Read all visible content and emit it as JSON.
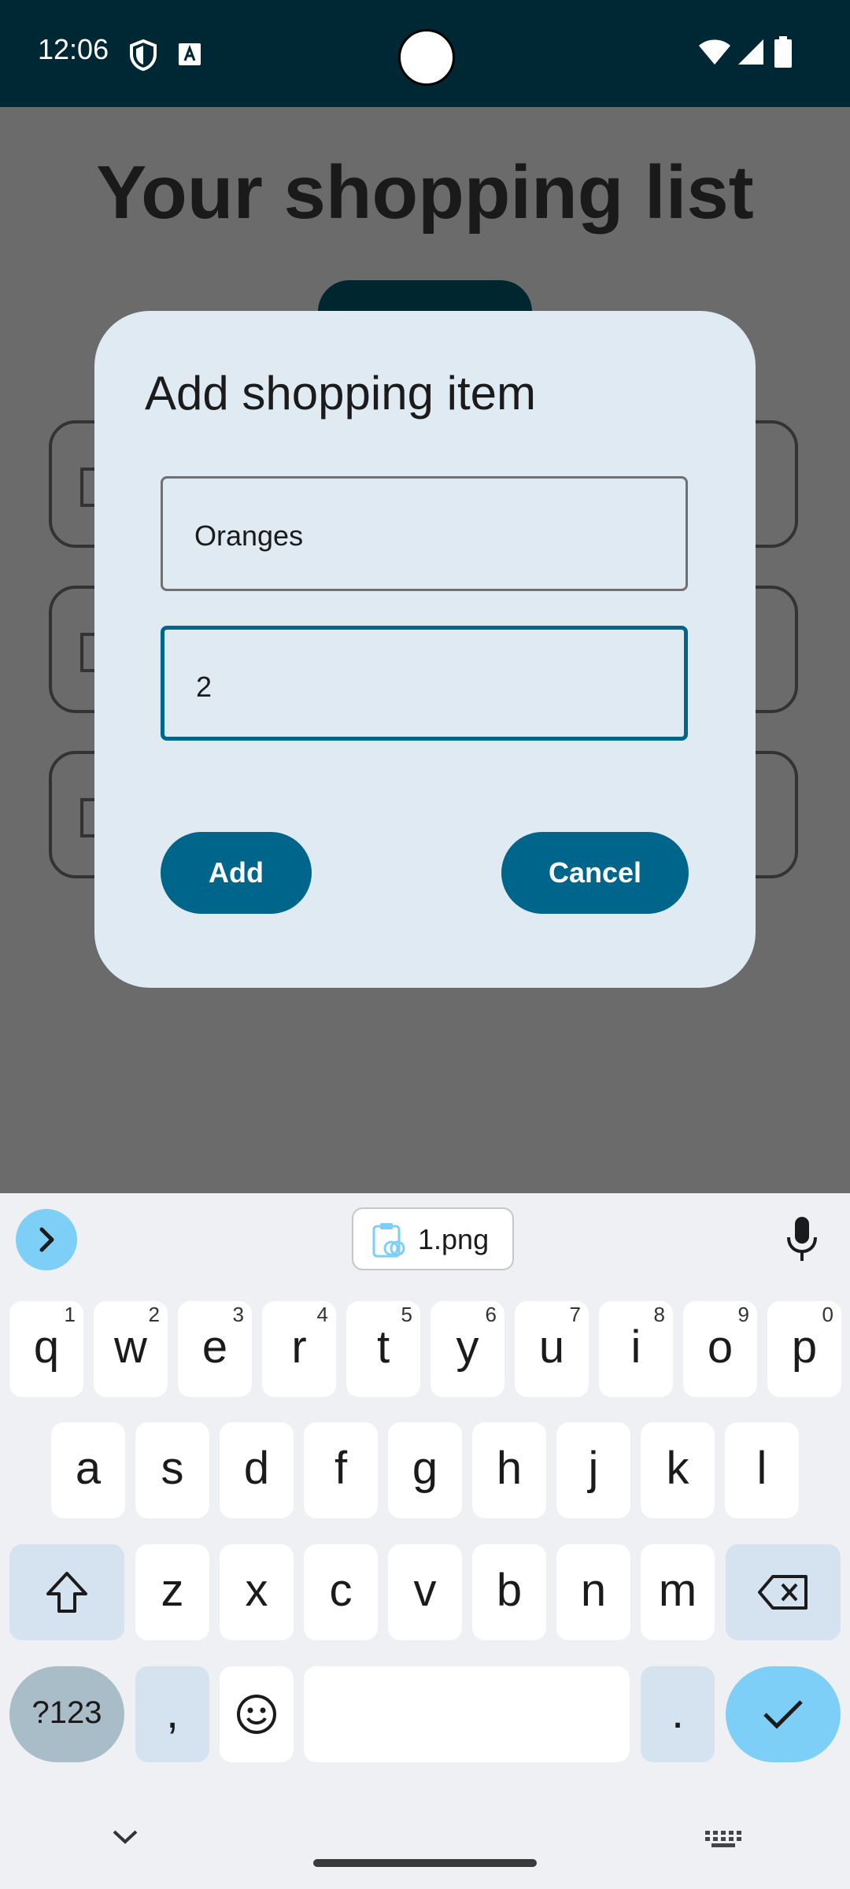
{
  "status_bar": {
    "time": "12:06",
    "icons": [
      "shield-icon",
      "a-icon",
      "wifi-icon",
      "signal-icon",
      "battery-icon"
    ]
  },
  "background": {
    "title": "Your shopping list"
  },
  "dialog": {
    "title": "Add shopping item",
    "name_field": {
      "value": "Oranges"
    },
    "quantity_field": {
      "value": "2"
    },
    "add_label": "Add",
    "cancel_label": "Cancel"
  },
  "keyboard": {
    "clipboard_label": "1.png",
    "row1": [
      {
        "k": "q",
        "h": "1"
      },
      {
        "k": "w",
        "h": "2"
      },
      {
        "k": "e",
        "h": "3"
      },
      {
        "k": "r",
        "h": "4"
      },
      {
        "k": "t",
        "h": "5"
      },
      {
        "k": "y",
        "h": "6"
      },
      {
        "k": "u",
        "h": "7"
      },
      {
        "k": "i",
        "h": "8"
      },
      {
        "k": "o",
        "h": "9"
      },
      {
        "k": "p",
        "h": "0"
      }
    ],
    "row2": [
      "a",
      "s",
      "d",
      "f",
      "g",
      "h",
      "j",
      "k",
      "l"
    ],
    "row3": [
      "z",
      "x",
      "c",
      "v",
      "b",
      "n",
      "m"
    ],
    "sym_label": "?123",
    "comma_label": ",",
    "period_label": "."
  },
  "colors": {
    "status_bar": "#002734",
    "accent": "#00658b",
    "dialog_bg": "#e0eaf2",
    "keyboard_accent": "#7dcff7"
  }
}
